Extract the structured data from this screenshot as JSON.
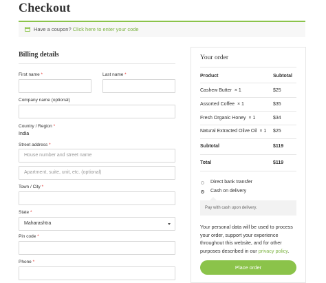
{
  "page": {
    "title": "Checkout"
  },
  "coupon": {
    "prefix": "Have a coupon?",
    "link": "Click here to enter your code"
  },
  "billing": {
    "title": "Billing details",
    "first_name": {
      "label": "First name",
      "required": "*",
      "value": ""
    },
    "last_name": {
      "label": "Last name",
      "required": "*",
      "value": ""
    },
    "company": {
      "label": "Company name (optional)",
      "value": ""
    },
    "country": {
      "label": "Country / Region",
      "required": "*",
      "value": "India"
    },
    "street": {
      "label": "Street address",
      "required": "*",
      "placeholder1": "House number and street name",
      "placeholder2": "Apartment, suite, unit, etc. (optional)"
    },
    "city": {
      "label": "Town / City",
      "required": "*",
      "value": ""
    },
    "state": {
      "label": "State",
      "required": "*",
      "value": "Maharashtra"
    },
    "pin": {
      "label": "Pin code",
      "required": "*",
      "value": ""
    },
    "phone": {
      "label": "Phone",
      "required": "*",
      "value": ""
    }
  },
  "order": {
    "title": "Your order",
    "head_product": "Product",
    "head_subtotal": "Subtotal",
    "items": [
      {
        "name": "Cashew Butter",
        "qty": "× 1",
        "price": "$25"
      },
      {
        "name": "Assorted Coffee",
        "qty": "× 1",
        "price": "$35"
      },
      {
        "name": "Fresh Organic Honey",
        "qty": "× 1",
        "price": "$34"
      },
      {
        "name": "Natural Extracted Olive Oil",
        "qty": "× 1",
        "price": "$25"
      }
    ],
    "subtotal_label": "Subtotal",
    "subtotal_value": "$119",
    "total_label": "Total",
    "total_value": "$119"
  },
  "payment": {
    "options": [
      {
        "label": "Direct bank transfer",
        "selected": false
      },
      {
        "label": "Cash on delivery",
        "selected": true
      }
    ],
    "note": "Pay with cash upon delivery."
  },
  "privacy": {
    "text": "Your personal data will be used to process your order, support your experience throughout this website, and for other purposes described in our",
    "link": "privacy policy",
    "end": "."
  },
  "place_order": "Place order",
  "colors": {
    "accent": "#8bc34a",
    "link": "#7cb342",
    "required": "#e53935"
  }
}
